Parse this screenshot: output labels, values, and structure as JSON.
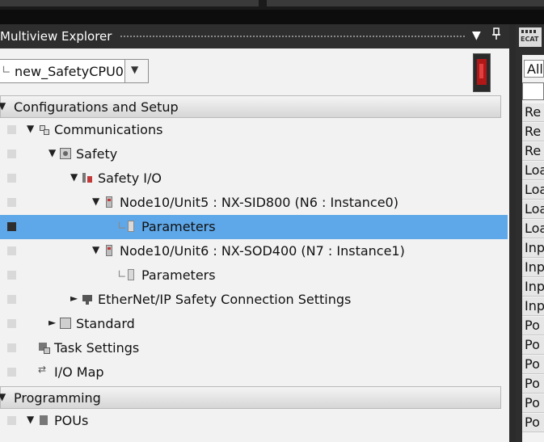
{
  "explorer": {
    "title": "Multiview Explorer",
    "dropdown_glyph": "▼",
    "pin_glyph": "📌",
    "selector_value": "new_SafetyCPU0",
    "selector_tee": "∟",
    "selector_arrow": "▼"
  },
  "sections": {
    "config": "Configurations and Setup",
    "programming": "Programming",
    "caret": "▼"
  },
  "tree": [
    {
      "label": "Communications",
      "expander": "▼"
    },
    {
      "label": "Safety",
      "expander": "▼"
    },
    {
      "label": "Safety I/O",
      "expander": "▼"
    },
    {
      "label": "Node10/Unit5 : NX-SID800 (N6 : Instance0)",
      "expander": "▼"
    },
    {
      "label": "Parameters",
      "tee": "∟"
    },
    {
      "label": "Node10/Unit6 : NX-SOD400 (N7 : Instance1)",
      "expander": "▼"
    },
    {
      "label": "Parameters",
      "tee": "∟"
    },
    {
      "label": "EtherNet/IP Safety Connection Settings",
      "expander": "►"
    },
    {
      "label": "Standard",
      "expander": "►"
    },
    {
      "label": "Task Settings"
    },
    {
      "label": "I/O Map"
    },
    {
      "label": "POUs",
      "expander": "▼"
    }
  ],
  "right_panel": {
    "filter_value": "All",
    "items": [
      "Re",
      "Re",
      "Re",
      "Loa",
      "Loa",
      "Loa",
      "Loa",
      "Inp",
      "Inp",
      "Inp",
      "Inp",
      "Po",
      "Po",
      "Po",
      "Po",
      "Po",
      "Po"
    ]
  }
}
